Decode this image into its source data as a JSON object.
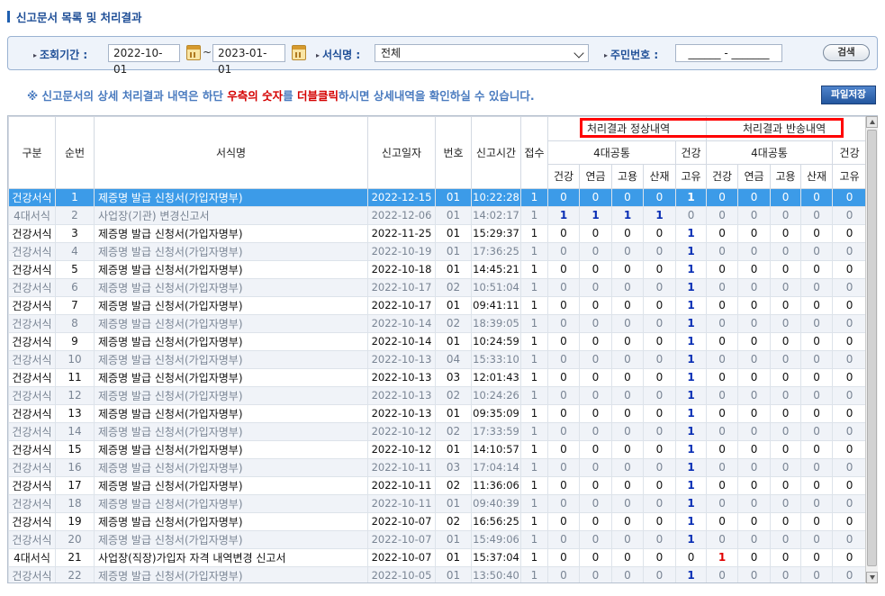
{
  "page_title": "신고문서 목록 및 처리결과",
  "search": {
    "period_label": "조회기간 :",
    "date_from": "2022-10-01",
    "tilde": "~",
    "date_to": "2023-01-01",
    "form_label": "서식명 :",
    "form_value": "전체",
    "resident_label": "주민번호 :",
    "resident_value": "______ - _______",
    "search_button": "검색"
  },
  "notice": {
    "part1": "※ 신고문서의 상세 처리결과 내역은 하단 ",
    "red1": "우측의 숫자",
    "part2": "를 ",
    "red2": "더블클릭",
    "part3": "하시면 상세내역을 확인하실 수 있습니다."
  },
  "save_button": "파일저장",
  "highlight": {
    "normal_label": "처리결과 정상내역",
    "return_label": "처리결과 반송내역"
  },
  "headers": {
    "type": "구분",
    "seq": "순번",
    "form": "서식명",
    "date": "신고일자",
    "no": "번호",
    "time": "신고시간",
    "recv": "접수",
    "four": "4대공통",
    "health": "건강",
    "unique": "고유",
    "health_sub": "건강",
    "pension": "연금",
    "employ": "고용",
    "accident": "산재"
  },
  "rows": [
    {
      "type": "건강서식",
      "seq": "1",
      "form": "제증명 발급 신청서(가입자명부)",
      "date": "2022-12-15",
      "no": "01",
      "time": "10:22:28",
      "recv": "1",
      "n": [
        "0",
        "0",
        "0",
        "0",
        "1"
      ],
      "r": [
        "0",
        "0",
        "0",
        "0",
        "0"
      ]
    },
    {
      "type": "4대서식",
      "seq": "2",
      "form": "사업장(기관) 변경신고서",
      "date": "2022-12-06",
      "no": "01",
      "time": "14:02:17",
      "recv": "1",
      "n": [
        "1",
        "1",
        "1",
        "1",
        "0"
      ],
      "r": [
        "0",
        "0",
        "0",
        "0",
        "0"
      ]
    },
    {
      "type": "건강서식",
      "seq": "3",
      "form": "제증명 발급 신청서(가입자명부)",
      "date": "2022-11-25",
      "no": "01",
      "time": "15:29:37",
      "recv": "1",
      "n": [
        "0",
        "0",
        "0",
        "0",
        "1"
      ],
      "r": [
        "0",
        "0",
        "0",
        "0",
        "0"
      ]
    },
    {
      "type": "건강서식",
      "seq": "4",
      "form": "제증명 발급 신청서(가입자명부)",
      "date": "2022-10-19",
      "no": "01",
      "time": "17:36:25",
      "recv": "1",
      "n": [
        "0",
        "0",
        "0",
        "0",
        "1"
      ],
      "r": [
        "0",
        "0",
        "0",
        "0",
        "0"
      ]
    },
    {
      "type": "건강서식",
      "seq": "5",
      "form": "제증명 발급 신청서(가입자명부)",
      "date": "2022-10-18",
      "no": "01",
      "time": "14:45:21",
      "recv": "1",
      "n": [
        "0",
        "0",
        "0",
        "0",
        "1"
      ],
      "r": [
        "0",
        "0",
        "0",
        "0",
        "0"
      ]
    },
    {
      "type": "건강서식",
      "seq": "6",
      "form": "제증명 발급 신청서(가입자명부)",
      "date": "2022-10-17",
      "no": "02",
      "time": "10:51:04",
      "recv": "1",
      "n": [
        "0",
        "0",
        "0",
        "0",
        "1"
      ],
      "r": [
        "0",
        "0",
        "0",
        "0",
        "0"
      ]
    },
    {
      "type": "건강서식",
      "seq": "7",
      "form": "제증명 발급 신청서(가입자명부)",
      "date": "2022-10-17",
      "no": "01",
      "time": "09:41:11",
      "recv": "1",
      "n": [
        "0",
        "0",
        "0",
        "0",
        "1"
      ],
      "r": [
        "0",
        "0",
        "0",
        "0",
        "0"
      ]
    },
    {
      "type": "건강서식",
      "seq": "8",
      "form": "제증명 발급 신청서(가입자명부)",
      "date": "2022-10-14",
      "no": "02",
      "time": "18:39:05",
      "recv": "1",
      "n": [
        "0",
        "0",
        "0",
        "0",
        "1"
      ],
      "r": [
        "0",
        "0",
        "0",
        "0",
        "0"
      ]
    },
    {
      "type": "건강서식",
      "seq": "9",
      "form": "제증명 발급 신청서(가입자명부)",
      "date": "2022-10-14",
      "no": "01",
      "time": "10:24:59",
      "recv": "1",
      "n": [
        "0",
        "0",
        "0",
        "0",
        "1"
      ],
      "r": [
        "0",
        "0",
        "0",
        "0",
        "0"
      ]
    },
    {
      "type": "건강서식",
      "seq": "10",
      "form": "제증명 발급 신청서(가입자명부)",
      "date": "2022-10-13",
      "no": "04",
      "time": "15:33:10",
      "recv": "1",
      "n": [
        "0",
        "0",
        "0",
        "0",
        "1"
      ],
      "r": [
        "0",
        "0",
        "0",
        "0",
        "0"
      ]
    },
    {
      "type": "건강서식",
      "seq": "11",
      "form": "제증명 발급 신청서(가입자명부)",
      "date": "2022-10-13",
      "no": "03",
      "time": "12:01:43",
      "recv": "1",
      "n": [
        "0",
        "0",
        "0",
        "0",
        "1"
      ],
      "r": [
        "0",
        "0",
        "0",
        "0",
        "0"
      ]
    },
    {
      "type": "건강서식",
      "seq": "12",
      "form": "제증명 발급 신청서(가입자명부)",
      "date": "2022-10-13",
      "no": "02",
      "time": "10:24:26",
      "recv": "1",
      "n": [
        "0",
        "0",
        "0",
        "0",
        "1"
      ],
      "r": [
        "0",
        "0",
        "0",
        "0",
        "0"
      ]
    },
    {
      "type": "건강서식",
      "seq": "13",
      "form": "제증명 발급 신청서(가입자명부)",
      "date": "2022-10-13",
      "no": "01",
      "time": "09:35:09",
      "recv": "1",
      "n": [
        "0",
        "0",
        "0",
        "0",
        "1"
      ],
      "r": [
        "0",
        "0",
        "0",
        "0",
        "0"
      ]
    },
    {
      "type": "건강서식",
      "seq": "14",
      "form": "제증명 발급 신청서(가입자명부)",
      "date": "2022-10-12",
      "no": "02",
      "time": "17:33:59",
      "recv": "1",
      "n": [
        "0",
        "0",
        "0",
        "0",
        "1"
      ],
      "r": [
        "0",
        "0",
        "0",
        "0",
        "0"
      ]
    },
    {
      "type": "건강서식",
      "seq": "15",
      "form": "제증명 발급 신청서(가입자명부)",
      "date": "2022-10-12",
      "no": "01",
      "time": "14:10:57",
      "recv": "1",
      "n": [
        "0",
        "0",
        "0",
        "0",
        "1"
      ],
      "r": [
        "0",
        "0",
        "0",
        "0",
        "0"
      ]
    },
    {
      "type": "건강서식",
      "seq": "16",
      "form": "제증명 발급 신청서(가입자명부)",
      "date": "2022-10-11",
      "no": "03",
      "time": "17:04:14",
      "recv": "1",
      "n": [
        "0",
        "0",
        "0",
        "0",
        "1"
      ],
      "r": [
        "0",
        "0",
        "0",
        "0",
        "0"
      ]
    },
    {
      "type": "건강서식",
      "seq": "17",
      "form": "제증명 발급 신청서(가입자명부)",
      "date": "2022-10-11",
      "no": "02",
      "time": "11:36:06",
      "recv": "1",
      "n": [
        "0",
        "0",
        "0",
        "0",
        "1"
      ],
      "r": [
        "0",
        "0",
        "0",
        "0",
        "0"
      ]
    },
    {
      "type": "건강서식",
      "seq": "18",
      "form": "제증명 발급 신청서(가입자명부)",
      "date": "2022-10-11",
      "no": "01",
      "time": "09:40:39",
      "recv": "1",
      "n": [
        "0",
        "0",
        "0",
        "0",
        "1"
      ],
      "r": [
        "0",
        "0",
        "0",
        "0",
        "0"
      ]
    },
    {
      "type": "건강서식",
      "seq": "19",
      "form": "제증명 발급 신청서(가입자명부)",
      "date": "2022-10-07",
      "no": "02",
      "time": "16:56:25",
      "recv": "1",
      "n": [
        "0",
        "0",
        "0",
        "0",
        "1"
      ],
      "r": [
        "0",
        "0",
        "0",
        "0",
        "0"
      ]
    },
    {
      "type": "건강서식",
      "seq": "20",
      "form": "제증명 발급 신청서(가입자명부)",
      "date": "2022-10-07",
      "no": "01",
      "time": "15:49:06",
      "recv": "1",
      "n": [
        "0",
        "0",
        "0",
        "0",
        "1"
      ],
      "r": [
        "0",
        "0",
        "0",
        "0",
        "0"
      ]
    },
    {
      "type": "4대서식",
      "seq": "21",
      "form": "사업장(직장)가입자 자격 내역변경 신고서",
      "date": "2022-10-07",
      "no": "01",
      "time": "15:37:04",
      "recv": "1",
      "n": [
        "0",
        "0",
        "0",
        "0",
        "0"
      ],
      "r": [
        "1",
        "0",
        "0",
        "0",
        "0"
      ]
    },
    {
      "type": "건강서식",
      "seq": "22",
      "form": "제증명 발급 신청서(가입자명부)",
      "date": "2022-10-05",
      "no": "01",
      "time": "13:50:40",
      "recv": "1",
      "n": [
        "0",
        "0",
        "0",
        "0",
        "1"
      ],
      "r": [
        "0",
        "0",
        "0",
        "0",
        "0"
      ]
    }
  ],
  "colors": {
    "accent": "#1f4f97",
    "selected_row": "#3c9be8",
    "positive_normal": "#0a2fb5",
    "positive_return": "#e00000",
    "highlight_border": "#ff0000"
  }
}
